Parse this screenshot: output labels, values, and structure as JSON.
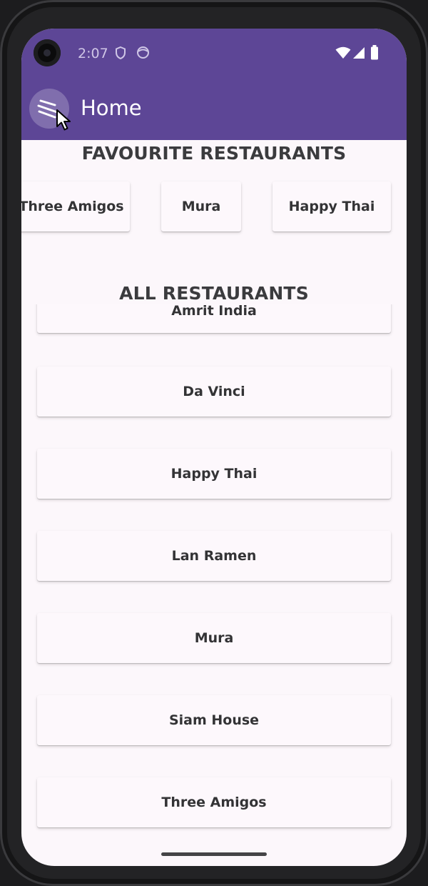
{
  "status_bar": {
    "time": "2:07",
    "icons": [
      "shield-icon",
      "face-icon",
      "wifi-icon",
      "signal-icon",
      "battery-icon"
    ]
  },
  "app_bar": {
    "title": "Home",
    "menu_icon": "menu-icon",
    "color": "#5d4696"
  },
  "favourites": {
    "heading": "FAVOURITE RESTAURANTS",
    "items": [
      "Three Amigos",
      "Mura",
      "Happy Thai"
    ]
  },
  "all_restaurants": {
    "heading": "ALL RESTAURANTS",
    "items": [
      "Amrit India",
      "Da Vinci",
      "Happy Thai",
      "Lan Ramen",
      "Mura",
      "Siam House",
      "Three Amigos"
    ]
  },
  "colors": {
    "background": "#fcf7fb",
    "card": "#fdf8fc",
    "text": "#333335"
  }
}
